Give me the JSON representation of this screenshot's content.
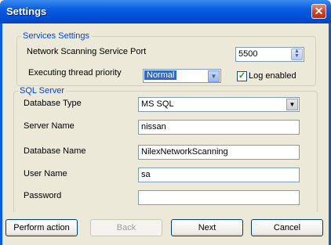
{
  "window": {
    "title": "Settings"
  },
  "services": {
    "legend": "Services Settings",
    "port_label": "Network Scanning Service Port",
    "port_value": "5500",
    "priority_label": "Executing thread priority",
    "priority_value": "Normal",
    "log_label": "Log enabled",
    "log_checked": true
  },
  "sql": {
    "legend": "SQL Server",
    "db_type_label": "Database Type",
    "db_type_value": "MS SQL",
    "server_label": "Server Name",
    "server_value": "nissan",
    "db_name_label": "Database Name",
    "db_name_value": "NilexNetworkScanning",
    "user_label": "User Name",
    "user_value": "sa",
    "password_label": "Password",
    "password_value": ""
  },
  "buttons": {
    "perform": "Perform action",
    "back": "Back",
    "next": "Next",
    "cancel": "Cancel"
  },
  "icons": {
    "close": "close-icon",
    "spin": "spin-updown-icon",
    "dropdown": "chevron-down-icon",
    "check": "checkmark-icon"
  },
  "colors": {
    "titlebar": "#0a5ce0",
    "legend": "#0046d5",
    "selection": "#316ac5"
  }
}
